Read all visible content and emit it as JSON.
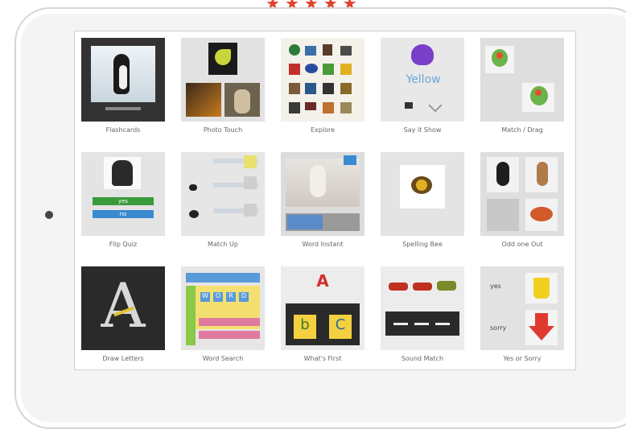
{
  "rating": {
    "stars": 5,
    "color": "#e0442e"
  },
  "apps": [
    {
      "label": "Flashcards"
    },
    {
      "label": "Photo Touch"
    },
    {
      "label": "Explore"
    },
    {
      "label": "Say it Show"
    },
    {
      "label": "Match / Drag"
    },
    {
      "label": "Flip Quiz"
    },
    {
      "label": "Match Up"
    },
    {
      "label": "Word Instant"
    },
    {
      "label": "Spelling Bee"
    },
    {
      "label": "Odd one Out"
    },
    {
      "label": "Draw Letters"
    },
    {
      "label": "Word Search"
    },
    {
      "label": "What's First"
    },
    {
      "label": "Sound Match"
    },
    {
      "label": "Yes or Sorry"
    }
  ],
  "thumb_text": {
    "say_it": "Yellow",
    "flip_yes": "yes",
    "flip_no": "no",
    "abc_a": "A",
    "abc_b": "b",
    "abc_c": "C",
    "letter": "A",
    "yes_word": "yes",
    "sorry_word": "sorry",
    "word_letters": [
      "W",
      "O",
      "R",
      "D"
    ]
  }
}
